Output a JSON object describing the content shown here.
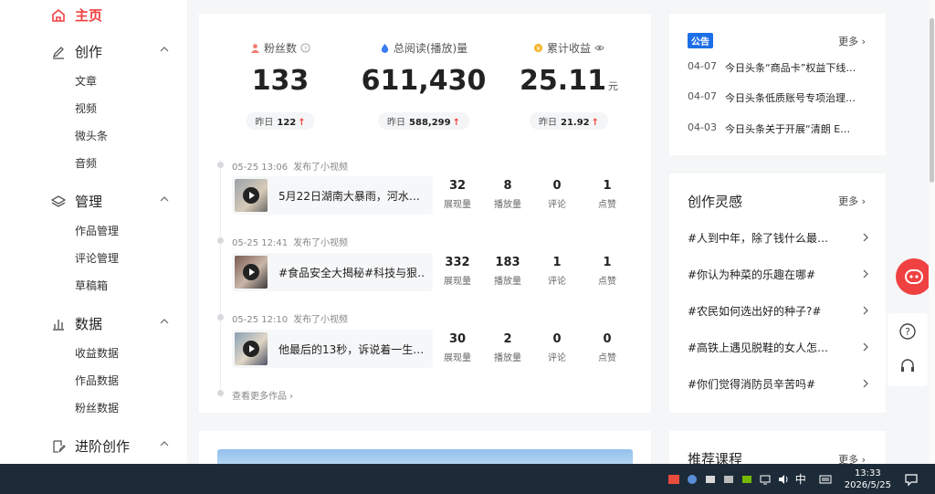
{
  "sidebar": {
    "home": "主页",
    "groups": [
      {
        "label": "创作",
        "items": [
          "文章",
          "视频",
          "微头条",
          "音频"
        ]
      },
      {
        "label": "管理",
        "items": [
          "作品管理",
          "评论管理",
          "草稿箱"
        ]
      },
      {
        "label": "数据",
        "items": [
          "收益数据",
          "作品数据",
          "粉丝数据"
        ]
      },
      {
        "label": "进阶创作",
        "items": []
      }
    ]
  },
  "stats": [
    {
      "label": "粉丝数",
      "value": "133",
      "unit": "",
      "yesterday_label": "昨日",
      "yesterday_value": "122",
      "trend": "↑"
    },
    {
      "label": "总阅读(播放)量",
      "value": "611,430",
      "unit": "",
      "yesterday_label": "昨日",
      "yesterday_value": "588,299",
      "trend": "↑"
    },
    {
      "label": "累计收益",
      "value": "25.11",
      "unit": "元",
      "yesterday_label": "昨日",
      "yesterday_value": "21.92",
      "trend": "↑"
    }
  ],
  "posts": [
    {
      "time": "05-25 13:06",
      "action": "发布了小视频",
      "title": "5月22日湖南大暴雨，河水…",
      "metrics": [
        "32",
        "8",
        "0",
        "1"
      ]
    },
    {
      "time": "05-25 12:41",
      "action": "发布了小视频",
      "title": "#食品安全大揭秘#科技与狠…",
      "metrics": [
        "332",
        "183",
        "1",
        "1"
      ]
    },
    {
      "time": "05-25 12:10",
      "action": "发布了小视频",
      "title": "他最后的13秒，诉说着一生…",
      "metrics": [
        "30",
        "2",
        "0",
        "0"
      ]
    }
  ],
  "metric_labels": [
    "展现量",
    "播放量",
    "评论",
    "点赞"
  ],
  "more_works": "查看更多作品",
  "notice": {
    "badge": "公告",
    "more": "更多",
    "items": [
      {
        "date": "04-07",
        "text": "今日头条“商品卡”权益下线…"
      },
      {
        "date": "04-07",
        "text": "今日头条低质账号专项治理…"
      },
      {
        "date": "04-03",
        "text": "今日头条关于开展“清朗 E…"
      }
    ]
  },
  "inspiration": {
    "title": "创作灵感",
    "more": "更多",
    "items": [
      "#人到中年，除了钱什么最…",
      "#你认为种菜的乐趣在哪#",
      "#农民如何选出好的种子?#",
      "#高铁上遇见脱鞋的女人怎…",
      "#你们觉得消防员辛苦吗#"
    ]
  },
  "courses": {
    "title": "推荐课程",
    "more": "更多"
  },
  "taskbar": {
    "ime": "中",
    "time": "13:33",
    "date": "2026/5/25"
  },
  "colors": {
    "brand": "#f04142",
    "accent_blue": "#1d6fe8",
    "taskbar": "#1d2b38"
  }
}
